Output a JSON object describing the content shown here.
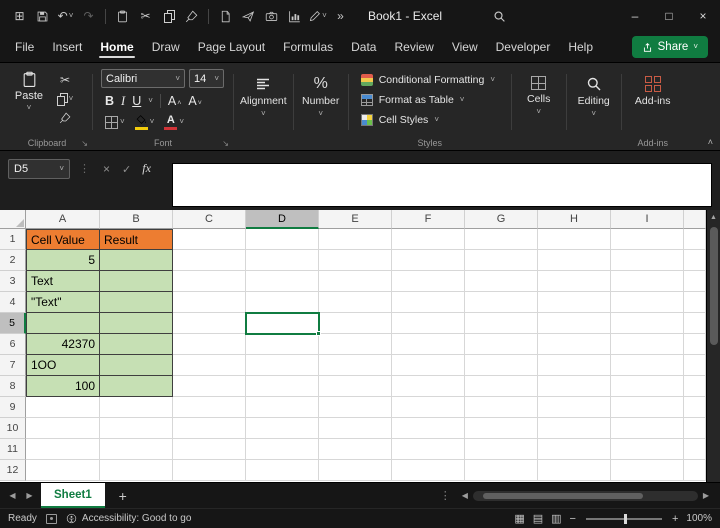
{
  "colors": {
    "accent_green": "#107C41",
    "header_fill_orange": "#ED7D31",
    "data_fill_green": "#C6E0B4",
    "font_color_accent": "#D13438",
    "fill_color_accent": "#F2CC0C",
    "dark_chrome": "#161616",
    "ribbon_bg": "#262626"
  },
  "titlebar": {
    "title": "Book1 - Excel",
    "minimize": "–",
    "maximize": "□",
    "close": "×",
    "icons": [
      {
        "name": "grid-icon",
        "glyph": "⊞"
      },
      {
        "name": "save-icon",
        "svg": "i-floppy"
      },
      {
        "name": "undo-icon",
        "glyph": "↶",
        "chevron": true
      },
      {
        "name": "redo-icon",
        "glyph": "↷",
        "dim": true
      },
      {
        "name": "divider"
      },
      {
        "name": "clipboard-icon",
        "svg": "i-clipboard"
      },
      {
        "name": "cut-icon",
        "glyph": "✂"
      },
      {
        "name": "copy-icon",
        "css": "copy-ic"
      },
      {
        "name": "format-painter-icon",
        "svg": "i-brush"
      },
      {
        "name": "divider"
      },
      {
        "name": "new-file-icon",
        "svg": "i-doc"
      },
      {
        "name": "send-icon",
        "svg": "i-plane"
      },
      {
        "name": "camera-icon",
        "svg": "i-camera"
      },
      {
        "name": "chart-icon",
        "svg": "i-chart"
      },
      {
        "name": "draw-icon",
        "svg": "i-pen",
        "chevron": true
      },
      {
        "name": "more-commands-icon",
        "glyph": "»"
      }
    ]
  },
  "menubar": {
    "items": [
      "File",
      "Insert",
      "Home",
      "Draw",
      "Page Layout",
      "Formulas",
      "Data",
      "Review",
      "View",
      "Developer",
      "Help"
    ],
    "active": "Home",
    "share_label": "Share"
  },
  "ribbon": {
    "clipboard": {
      "paste_label": "Paste",
      "group_label": "Clipboard"
    },
    "font": {
      "name": "Calibri",
      "size": "14",
      "bold": "B",
      "italic": "I",
      "underline": "U",
      "group_label": "Font"
    },
    "alignment_label": "Alignment",
    "number_label": "Number",
    "styles": {
      "conditional_formatting": "Conditional Formatting",
      "format_as_table": "Format as Table",
      "cell_styles": "Cell Styles",
      "group_label": "Styles"
    },
    "cells_label": "Cells",
    "editing_label": "Editing",
    "addins": {
      "button_label": "Add-ins",
      "group_label": "Add-ins"
    }
  },
  "formula_bar": {
    "name_box": "D5",
    "cancel": "×",
    "enter": "✓",
    "fx": "fx",
    "value": ""
  },
  "grid": {
    "columns": [
      "A",
      "B",
      "C",
      "D",
      "E",
      "F",
      "G",
      "H",
      "I"
    ],
    "row_count": 12,
    "header_fill_range": "A1:B1",
    "data_fill_range": "A2:B8",
    "border_range": "A1:B8",
    "selected_cell": "D5",
    "cells": {
      "A1": {
        "v": "Cell Value"
      },
      "B1": {
        "v": "Result"
      },
      "A2": {
        "v": "5",
        "align": "right"
      },
      "A3": {
        "v": "Text"
      },
      "A4": {
        "v": "\"Text\""
      },
      "A6": {
        "v": "42370",
        "align": "right"
      },
      "A7": {
        "v": "1OO"
      },
      "A8": {
        "v": "100",
        "align": "right"
      }
    }
  },
  "sheet_tabs": {
    "active_tab": "Sheet1",
    "add_label": "+"
  },
  "status_bar": {
    "ready_label": "Ready",
    "accessibility_label": "Accessibility: Good to go",
    "zoom_label": "100%"
  }
}
